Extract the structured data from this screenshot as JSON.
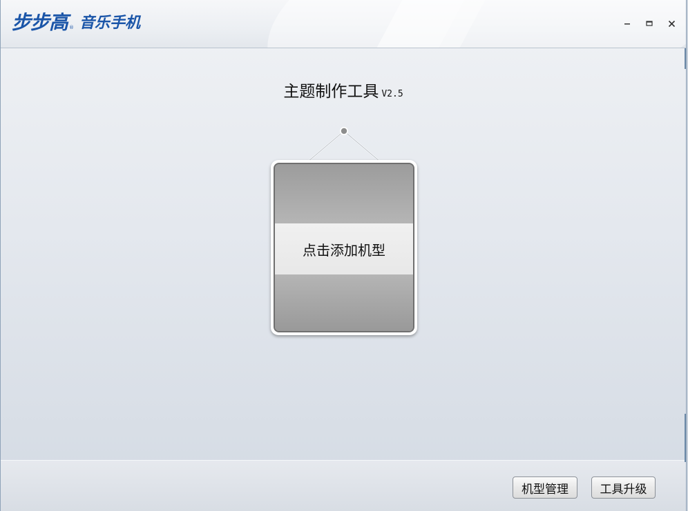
{
  "titlebar": {
    "brand_logo": "步步高",
    "brand_reg": "®",
    "brand_sub": "音乐手机",
    "controls": {
      "minimize_icon": "minimize-icon",
      "maximize_icon": "maximize-icon",
      "close_icon": "close-icon"
    }
  },
  "main": {
    "title": "主题制作工具",
    "version": "V2.5",
    "add_model_label": "点击添加机型"
  },
  "footer": {
    "model_manage_label": "机型管理",
    "tool_upgrade_label": "工具升级"
  },
  "colors": {
    "brand": "#1a55a8",
    "window_bg": "#e4e8ee",
    "card_band": "#ececec",
    "card_frame": "#9c9c9c"
  }
}
